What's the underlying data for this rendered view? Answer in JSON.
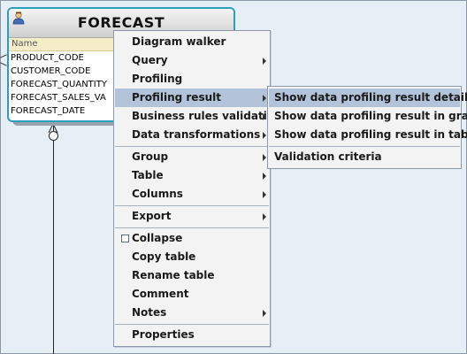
{
  "entity": {
    "title": "FORECAST",
    "column_header": "Name",
    "columns": [
      "PRODUCT_CODE",
      "CUSTOMER_CODE",
      "FORECAST_QUANTITY",
      "FORECAST_SALES_VA",
      "FORECAST_DATE"
    ]
  },
  "menu": {
    "items": [
      {
        "label": "Diagram walker"
      },
      {
        "label": "Query"
      },
      {
        "label": "Profiling"
      },
      {
        "label": "Profiling result"
      },
      {
        "label": "Business rules validation"
      },
      {
        "label": "Data transformations"
      },
      {
        "label": "Group"
      },
      {
        "label": "Table"
      },
      {
        "label": "Columns"
      },
      {
        "label": "Export"
      },
      {
        "label": "Collapse"
      },
      {
        "label": "Copy table"
      },
      {
        "label": "Rename table"
      },
      {
        "label": "Comment"
      },
      {
        "label": "Notes"
      },
      {
        "label": "Properties"
      }
    ]
  },
  "submenu": {
    "items": [
      {
        "label": "Show data profiling result details"
      },
      {
        "label": "Show data profiling result in graph"
      },
      {
        "label": "Show data profiling result in table"
      },
      {
        "label": "Validation criteria"
      }
    ]
  },
  "colors": {
    "selection": "#b3c4da",
    "entity_border": "#2aa0b8",
    "background": "#e6eef6"
  }
}
